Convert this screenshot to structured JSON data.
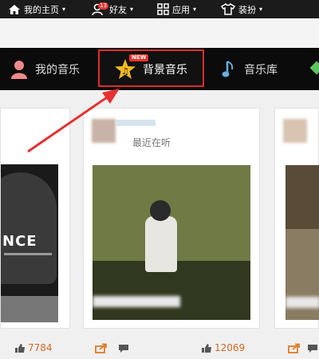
{
  "topbar": {
    "items": [
      {
        "label": "我的主页",
        "icon": "home-icon"
      },
      {
        "label": "好友",
        "icon": "friends-icon",
        "badge": "13"
      },
      {
        "label": "应用",
        "icon": "apps-grid-icon"
      },
      {
        "label": "装扮",
        "icon": "tshirt-icon"
      }
    ],
    "caret": "▾"
  },
  "nav": {
    "tabs": [
      {
        "label": "我的音乐",
        "icon": "person-icon"
      },
      {
        "label": "背景音乐",
        "icon": "star-music-icon",
        "tag": "NEW",
        "active": true
      },
      {
        "label": "音乐库",
        "icon": "music-note-icon"
      }
    ]
  },
  "feed": {
    "recent_label": "最近在听",
    "cards": [
      {
        "album_text": "NCE",
        "likes": "7784"
      },
      {
        "likes": "12069"
      }
    ]
  },
  "colors": {
    "active_border": "#e02b2b",
    "accent_orange": "#d06a26",
    "nav_bg": "#0b0b0b"
  }
}
